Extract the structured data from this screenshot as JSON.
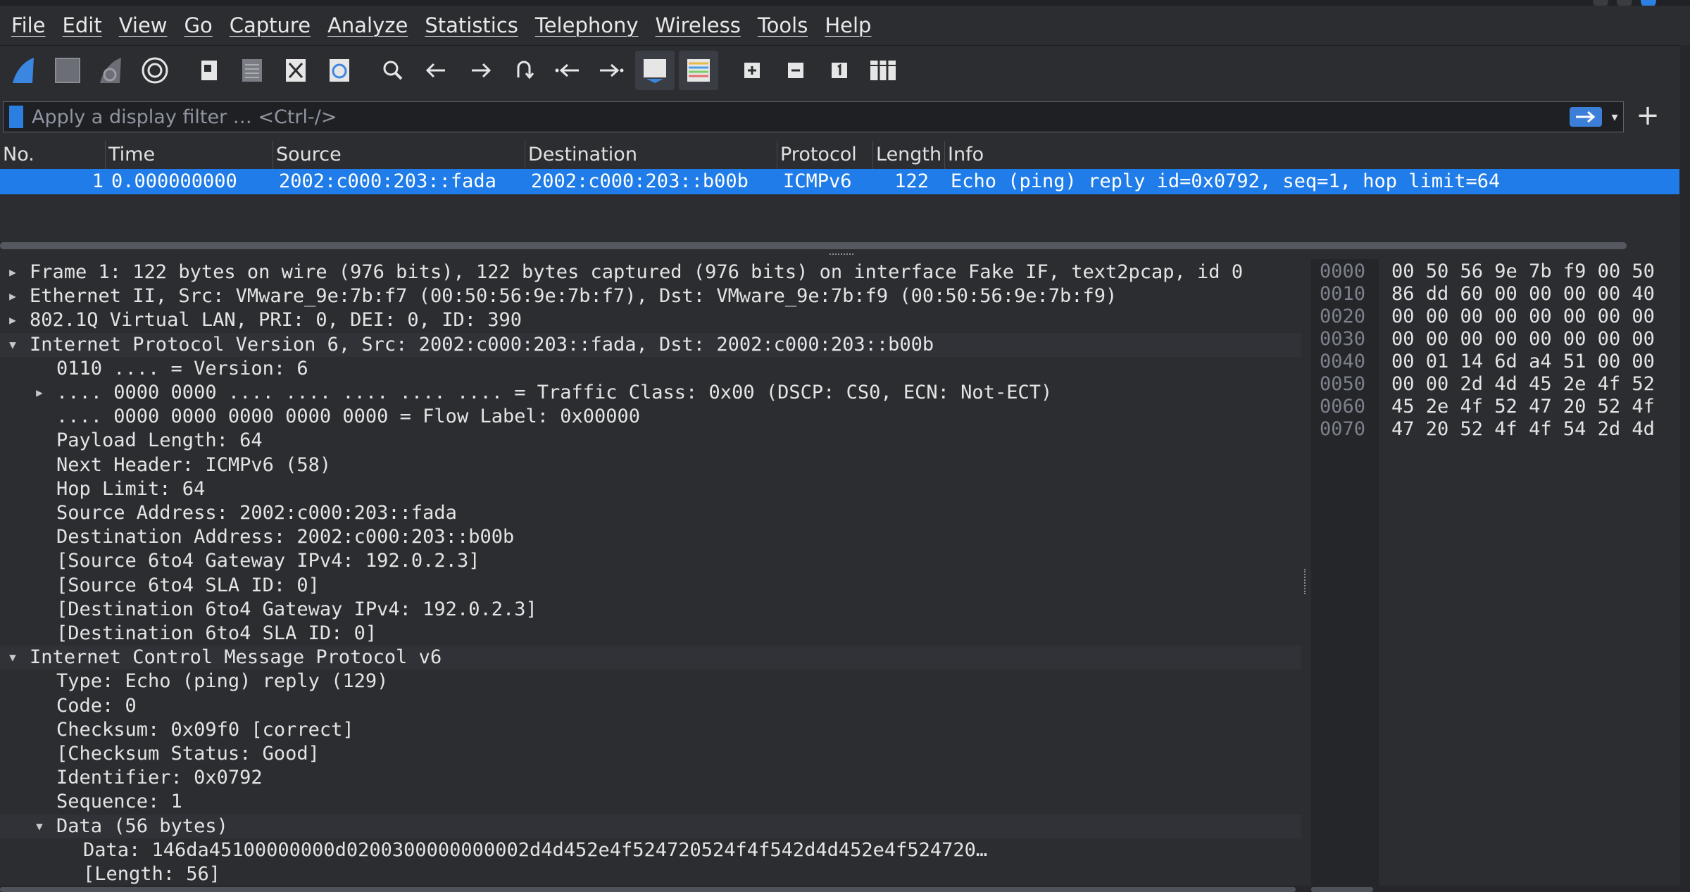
{
  "menu": [
    "File",
    "Edit",
    "View",
    "Go",
    "Capture",
    "Analyze",
    "Statistics",
    "Telephony",
    "Wireless",
    "Tools",
    "Help"
  ],
  "toolbar": {
    "icons": [
      "shark-fin-start-icon",
      "stop-square-icon",
      "restart-fin-icon",
      "options-gear-icon",
      "open-file-icon",
      "save-file-icon",
      "close-file-icon",
      "reload-file-icon",
      "find-packet-icon",
      "go-back-icon",
      "go-forward-icon",
      "go-to-packet-icon",
      "first-packet-icon",
      "last-packet-icon",
      "autoscroll-icon",
      "colorize-icon",
      "zoom-in-icon",
      "zoom-out-icon",
      "normal-size-icon",
      "resize-columns-icon"
    ]
  },
  "filter": {
    "placeholder": "Apply a display filter … <Ctrl-/>"
  },
  "packet_list": {
    "columns": [
      "No.",
      "Time",
      "Source",
      "Destination",
      "Protocol",
      "Length",
      "Info"
    ],
    "rows": [
      {
        "no": "1",
        "time": "0.000000000",
        "source": "2002:c000:203::fada",
        "destination": "2002:c000:203::b00b",
        "protocol": "ICMPv6",
        "length": "122",
        "info": "Echo (ping) reply id=0x0792, seq=1, hop limit=64"
      }
    ]
  },
  "tree": [
    {
      "text": "Frame 1: 122 bytes on wire (976 bits), 122 bytes captured (976 bits) on interface Fake IF, text2pcap, id 0",
      "level": 0,
      "arrow": "collapsed"
    },
    {
      "text": "Ethernet II, Src: VMware_9e:7b:f7 (00:50:56:9e:7b:f7), Dst: VMware_9e:7b:f9 (00:50:56:9e:7b:f9)",
      "level": 0,
      "arrow": "collapsed"
    },
    {
      "text": "802.1Q Virtual LAN, PRI: 0, DEI: 0, ID: 390",
      "level": 0,
      "arrow": "collapsed"
    },
    {
      "text": "Internet Protocol Version 6, Src: 2002:c000:203::fada, Dst: 2002:c000:203::b00b",
      "level": 0,
      "arrow": "expanded"
    },
    {
      "text": "0110 .... = Version: 6",
      "level": 1,
      "arrow": "none"
    },
    {
      "text": ".... 0000 0000 .... .... .... .... .... = Traffic Class: 0x00 (DSCP: CS0, ECN: Not-ECT)",
      "level": 1,
      "arrow": "collapsed"
    },
    {
      "text": ".... 0000 0000 0000 0000 0000 = Flow Label: 0x00000",
      "level": 1,
      "arrow": "none"
    },
    {
      "text": "Payload Length: 64",
      "level": 1,
      "arrow": "none"
    },
    {
      "text": "Next Header: ICMPv6 (58)",
      "level": 1,
      "arrow": "none"
    },
    {
      "text": "Hop Limit: 64",
      "level": 1,
      "arrow": "none"
    },
    {
      "text": "Source Address: 2002:c000:203::fada",
      "level": 1,
      "arrow": "none"
    },
    {
      "text": "Destination Address: 2002:c000:203::b00b",
      "level": 1,
      "arrow": "none"
    },
    {
      "text": "[Source 6to4 Gateway IPv4: 192.0.2.3]",
      "level": 1,
      "arrow": "none"
    },
    {
      "text": "[Source 6to4 SLA ID: 0]",
      "level": 1,
      "arrow": "none"
    },
    {
      "text": "[Destination 6to4 Gateway IPv4: 192.0.2.3]",
      "level": 1,
      "arrow": "none"
    },
    {
      "text": "[Destination 6to4 SLA ID: 0]",
      "level": 1,
      "arrow": "none"
    },
    {
      "text": "Internet Control Message Protocol v6",
      "level": 0,
      "arrow": "expanded"
    },
    {
      "text": "Type: Echo (ping) reply (129)",
      "level": 1,
      "arrow": "none"
    },
    {
      "text": "Code: 0",
      "level": 1,
      "arrow": "none"
    },
    {
      "text": "Checksum: 0x09f0 [correct]",
      "level": 1,
      "arrow": "none"
    },
    {
      "text": "[Checksum Status: Good]",
      "level": 1,
      "arrow": "none"
    },
    {
      "text": "Identifier: 0x0792",
      "level": 1,
      "arrow": "none"
    },
    {
      "text": "Sequence: 1",
      "level": 1,
      "arrow": "none"
    },
    {
      "text": "Data (56 bytes)",
      "level": 1,
      "arrow": "expanded"
    },
    {
      "text": "Data: 146da45100000000d0200300000000002d4d452e4f524720524f4f542d4d452e4f524720…",
      "level": 2,
      "arrow": "none"
    },
    {
      "text": "[Length: 56]",
      "level": 2,
      "arrow": "none"
    }
  ],
  "hex": [
    {
      "offset": "0000",
      "bytes": "00 50 56 9e 7b f9 00 50"
    },
    {
      "offset": "0010",
      "bytes": "86 dd 60 00 00 00 00 40"
    },
    {
      "offset": "0020",
      "bytes": "00 00 00 00 00 00 00 00"
    },
    {
      "offset": "0030",
      "bytes": "00 00 00 00 00 00 00 00"
    },
    {
      "offset": "0040",
      "bytes": "00 01 14 6d a4 51 00 00"
    },
    {
      "offset": "0050",
      "bytes": "00 00 2d 4d 45 2e 4f 52"
    },
    {
      "offset": "0060",
      "bytes": "45 2e 4f 52 47 20 52 4f"
    },
    {
      "offset": "0070",
      "bytes": "47 20 52 4f 4f 54 2d 4d"
    }
  ],
  "colors": {
    "selection": "#1f7ce8",
    "background": "#2b2d31",
    "accent": "#2c7fe0"
  }
}
